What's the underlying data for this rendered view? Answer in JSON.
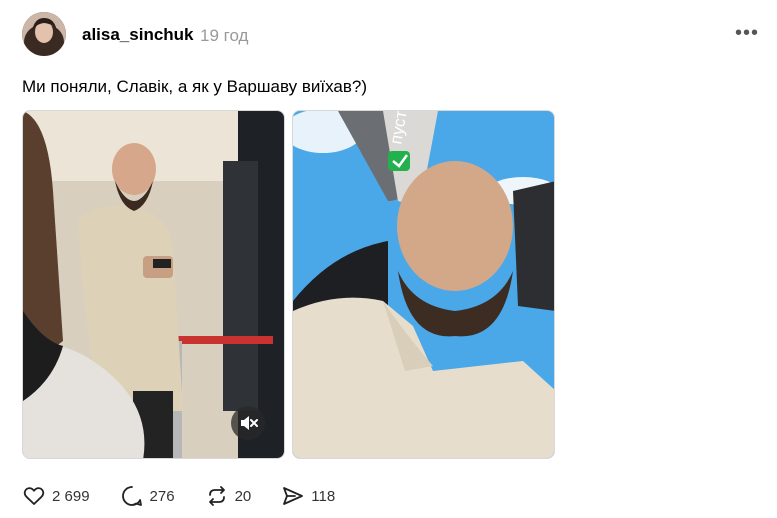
{
  "post": {
    "author": "alisa_sinchuk",
    "time": "19 год",
    "more_icon": "more-horizontal-icon",
    "text": "Ми поняли, Славік, а як у Варшаву виїхав?)",
    "media": [
      {
        "type": "video",
        "description_icon": "mute-icon"
      },
      {
        "type": "image",
        "sticker_text": "пустка"
      }
    ],
    "actions": {
      "likes": "2 699",
      "comments": "276",
      "reposts": "20",
      "shares": "118"
    }
  },
  "colors": {
    "text": "#000000",
    "muted": "#999999",
    "border": "#d8d8d8"
  }
}
